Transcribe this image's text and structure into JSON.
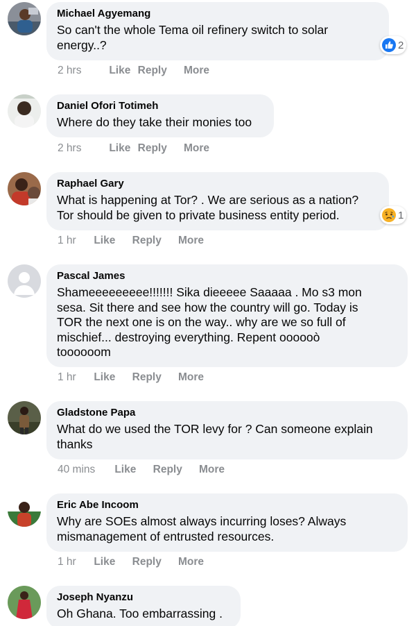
{
  "comments": [
    {
      "name": "Michael Agyemang",
      "text": "So can't the whole Tema oil refinery switch to solar\nenergy..?",
      "time": "2 hrs",
      "like": "Like",
      "reply": "Reply",
      "more": "More",
      "reaction": {
        "icon": "like-icon",
        "count": "2"
      },
      "avatar_colors": [
        "#6b6f7a",
        "#2f5f8f"
      ]
    },
    {
      "name": "Daniel Ofori Totimeh",
      "text": "Where do they take their monies too",
      "time": "2 hrs",
      "like": "Like",
      "reply": "Reply",
      "more": "More",
      "avatar_colors": [
        "#e8eae8",
        "#3a2a20"
      ]
    },
    {
      "name": "Raphael Gary",
      "text": "What is happening at Tor? . We are serious as a nation?\nTor should be given to private business entity period.",
      "time": "1 hr",
      "like": "Like",
      "reply": "Reply",
      "more": "More",
      "reaction": {
        "icon": "sad-icon",
        "count": "1"
      },
      "avatar_colors": [
        "#8a4a3a",
        "#c33a2a"
      ]
    },
    {
      "name": "Pascal James",
      "text": "Shameeeeeeeee!!!!!!! Sika dieeeee Saaaaa . Mo s3 mon\nsesa. Sit there and see how the country will go. Today is\nTOR the next one is on the way.. why are we so full of\nmischief... destroying everything. Repent oooooò\ntoooooom",
      "time": "1 hr",
      "like": "Like",
      "reply": "Reply",
      "more": "More",
      "avatar_colors": [
        "#d8dadf",
        "#ffffff"
      ]
    },
    {
      "name": "Gladstone Papa",
      "text": "What do we used the TOR levy for ? Can someone explain\nthanks",
      "time": "40 mins",
      "like": "Like",
      "reply": "Reply",
      "more": "More",
      "avatar_colors": [
        "#4a4f3a",
        "#7a5a3a"
      ]
    },
    {
      "name": "Eric Abe Incoom",
      "text": "Why are SOEs almost always incurring loses? Always\nmismanagement of entrusted resources.",
      "time": "1 hr",
      "like": "Like",
      "reply": "Reply",
      "more": "More",
      "avatar_colors": [
        "#3a7a3a",
        "#c8422a"
      ]
    },
    {
      "name": "Joseph Nyanzu",
      "text": "Oh Ghana. Too embarrassing .",
      "time": "",
      "like": "",
      "reply": "",
      "more": "",
      "avatar_colors": [
        "#5a8a4a",
        "#d0283a"
      ]
    }
  ],
  "colors": {
    "bubble": "#f0f2f5",
    "meta": "#8a8d91",
    "like_blue": "#1877f2",
    "sad_yellow": "#f7b125"
  }
}
